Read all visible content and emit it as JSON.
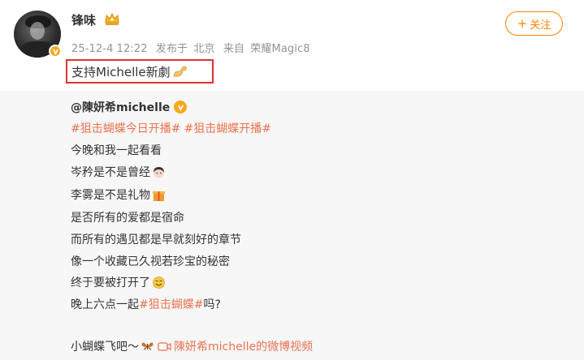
{
  "post": {
    "username": "锋味",
    "timestamp": "25-12-4 12:22",
    "source_prefix": "发布于",
    "location": "北京",
    "device_prefix": "来自",
    "device": "荣耀Magic8",
    "follow_label": "关注",
    "text": "支持Michelle新劇"
  },
  "repost": {
    "author": "@陳妍希michelle",
    "hashtag1": "#狙击蝴蝶今日开播#",
    "hashtag2": "#狙击蝴蝶开播#",
    "line1": "今晚和我一起看看",
    "line2": "岑矜是不是曾经",
    "line3": "李雾是不是礼物",
    "line4": "是否所有的爱都是宿命",
    "line5": "而所有的遇见都是早就刻好的章节",
    "line6": "像一个收藏已久视若珍宝的秘密",
    "line7": "终于要被打开了",
    "line8_prefix": "晚上六点一起",
    "line8_tag": "#狙击蝴蝶#",
    "line8_suffix": "吗?",
    "line9_prefix": "小蝴蝶飞吧～",
    "video_link": "陳妍希michelle的微博视频"
  },
  "colors": {
    "accent": "#ff8200",
    "link": "#eb7350",
    "highlight_border": "#e03030",
    "verified": "#f7a91e"
  },
  "icons": [
    "crown-icon",
    "verified-icon",
    "plus-icon",
    "flexed-arm-emoji",
    "girl-face-emoji",
    "gift-emoji",
    "smile-emoji",
    "butterfly-emoji",
    "video-icon"
  ]
}
